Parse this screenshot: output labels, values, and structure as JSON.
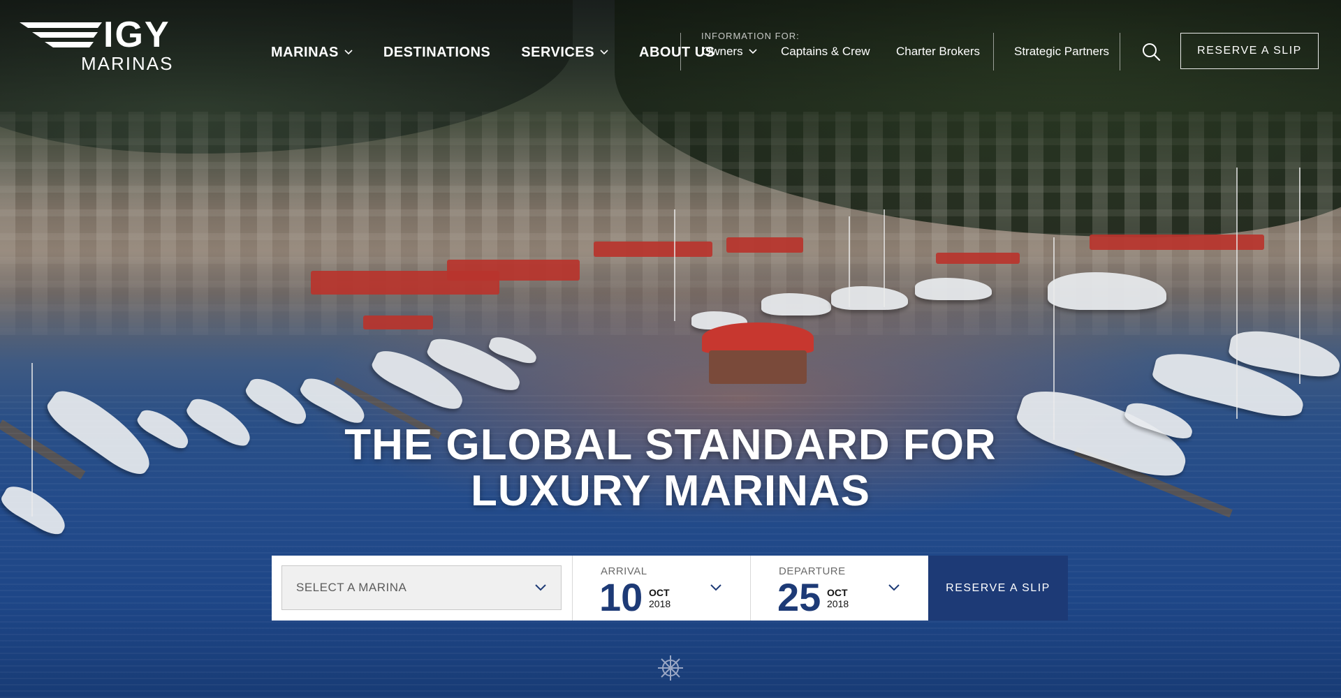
{
  "brand": {
    "logo_main": "IGY",
    "logo_sub": "MARINAS"
  },
  "nav": {
    "main": [
      {
        "label": "MARINAS",
        "dropdown": true
      },
      {
        "label": "DESTINATIONS",
        "dropdown": false
      },
      {
        "label": "SERVICES",
        "dropdown": true
      },
      {
        "label": "ABOUT US",
        "dropdown": false
      }
    ],
    "info_label": "INFORMATION FOR:",
    "audience": [
      {
        "label": "Owners",
        "dropdown": true
      },
      {
        "label": "Captains & Crew",
        "dropdown": false
      },
      {
        "label": "Charter Brokers",
        "dropdown": false
      },
      {
        "label": "Strategic Partners",
        "dropdown": false
      }
    ],
    "search_icon": "search-icon",
    "reserve_label": "RESERVE A SLIP"
  },
  "hero": {
    "title_line1": "THE GLOBAL STANDARD FOR",
    "title_line2": "LUXURY MARINAS"
  },
  "booking": {
    "marina_placeholder": "SELECT A MARINA",
    "arrival": {
      "label": "ARRIVAL",
      "day": "10",
      "month": "OCT",
      "year": "2018"
    },
    "departure": {
      "label": "DEPARTURE",
      "day": "25",
      "month": "OCT",
      "year": "2018"
    },
    "submit_label": "RESERVE A SLIP"
  },
  "footer": {
    "scroll_icon": "ship-wheel-icon"
  },
  "colors": {
    "brand_navy": "#1d3a76",
    "white": "#ffffff",
    "select_bg": "#f0f0f0"
  }
}
